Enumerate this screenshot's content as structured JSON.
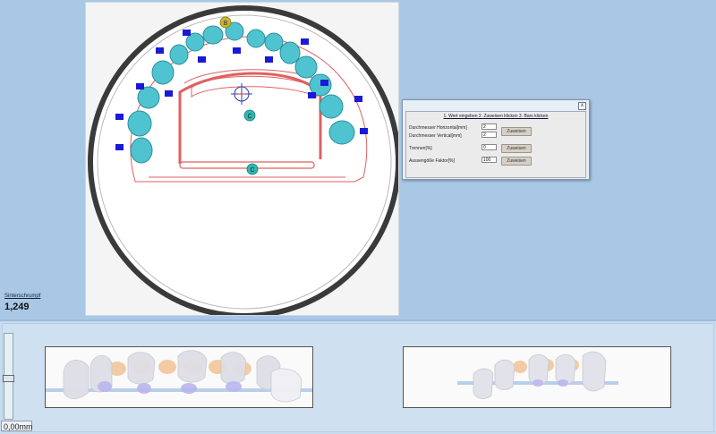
{
  "viewport": {
    "markers": {
      "b_marker": "B",
      "c_marker_inner": "C",
      "c_marker_bar": "C"
    },
    "tooth_color": "#4fc3cf",
    "connector_color": "#1a1ad6",
    "outline_color": "#e06060"
  },
  "shrinkage": {
    "label": "Sinterschrumpf",
    "value": "1,249"
  },
  "dialog": {
    "title": "1. Wert eingeben 2. Zuweisen klicken 3. Bars klicken",
    "close_glyph": "x",
    "diameter_h_label": "Durchmesser Horizontal[mm]",
    "diameter_h_value": "2",
    "diameter_v_label": "Durchmesser Vertical[mm]",
    "diameter_v_value": "2",
    "assign_diameter_label": "Zuweisen",
    "separator_label": "Trennen[%]",
    "separator_value": "0",
    "assign_separator_label": "Zuweisen",
    "scale_label": "Aussengöße Faktor[%]",
    "scale_value": "100",
    "assign_scale_label": "Zuweisen"
  },
  "bottom": {
    "slider_value": "0,00mm"
  }
}
